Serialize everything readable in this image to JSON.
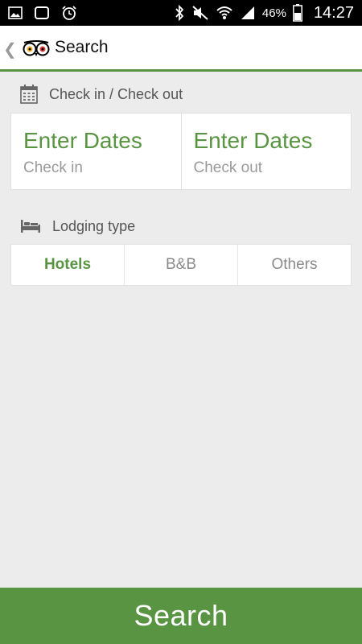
{
  "status_bar": {
    "battery_percent": "46%",
    "time": "14:27",
    "icons": [
      "gallery-icon",
      "square-notification-icon",
      "alarm-icon",
      "bluetooth-icon",
      "mute-icon",
      "wifi-icon",
      "signal-icon",
      "battery-icon"
    ]
  },
  "action_bar": {
    "title": "Search",
    "back_icon": "chevron-left-icon",
    "logo_icon": "owl-logo-icon"
  },
  "dates_section": {
    "header": "Check in / Check out",
    "icon": "calendar-icon",
    "check_in": {
      "value": "Enter Dates",
      "label": "Check in"
    },
    "check_out": {
      "value": "Enter Dates",
      "label": "Check out"
    }
  },
  "lodging_section": {
    "header": "Lodging type",
    "icon": "bed-icon",
    "options": [
      "Hotels",
      "B&B",
      "Others"
    ],
    "selected": "Hotels"
  },
  "search_button": {
    "label": "Search"
  },
  "colors": {
    "accent": "#589442",
    "background": "#ececec",
    "muted_text": "#9a9a9a"
  }
}
